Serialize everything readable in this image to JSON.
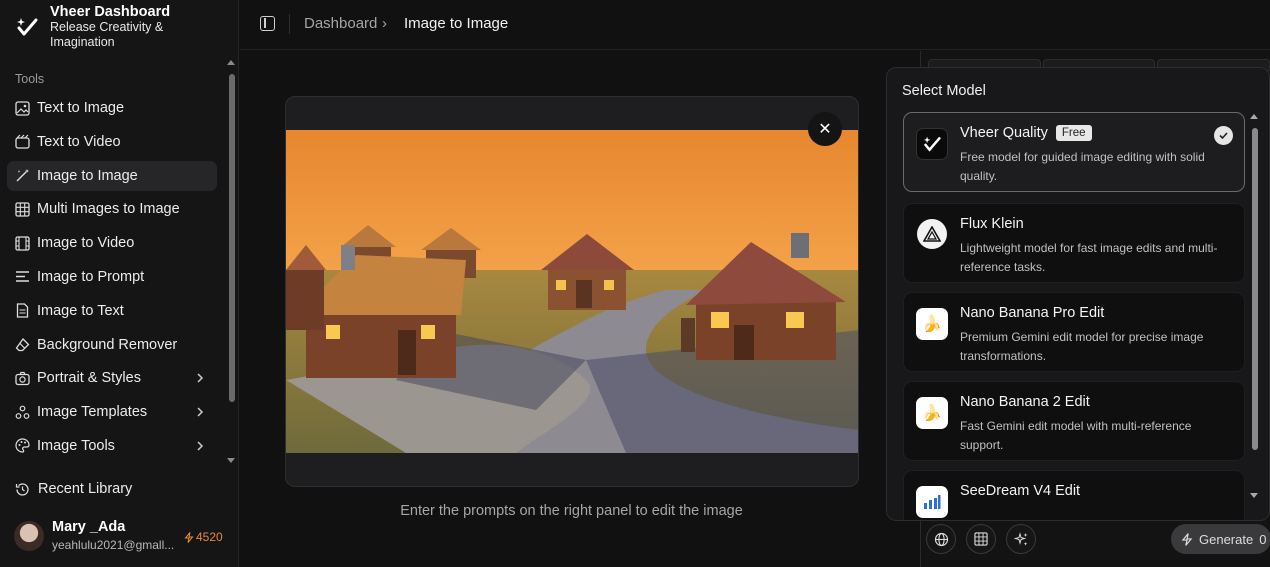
{
  "brand": {
    "title": "Vheer Dashboard",
    "subtitle_line1": "Release Creativity &",
    "subtitle_line2": "Imagination"
  },
  "sidebar": {
    "section_label": "Tools",
    "items": [
      {
        "label": "Text to Image",
        "icon": "image-icon"
      },
      {
        "label": "Text to Video",
        "icon": "video-icon"
      },
      {
        "label": "Image to Image",
        "icon": "magic-wand-icon",
        "active": true
      },
      {
        "label": "Multi Images to Image",
        "icon": "grid-icon"
      },
      {
        "label": "Image to Video",
        "icon": "film-icon"
      },
      {
        "label": "Image to Prompt",
        "icon": "text-lines-icon"
      },
      {
        "label": "Image to Text",
        "icon": "document-icon"
      },
      {
        "label": "Background Remover",
        "icon": "eraser-icon"
      },
      {
        "label": "Portrait & Styles",
        "icon": "camera-icon",
        "has_submenu": true
      },
      {
        "label": "Image Templates",
        "icon": "templates-icon",
        "has_submenu": true
      },
      {
        "label": "Image Tools",
        "icon": "palette-icon",
        "has_submenu": true
      }
    ],
    "recent": "Recent Library",
    "user": {
      "name": "Mary _Ada",
      "email": "yeahlulu2021@gmall...",
      "credits": "4520"
    }
  },
  "header": {
    "crumb_parent": "Dashboard",
    "crumb_current": "Image to Image"
  },
  "main": {
    "caption": "Enter the prompts on the right panel to edit the image"
  },
  "model_popup": {
    "title": "Select Model",
    "models": [
      {
        "name": "Vheer Quality",
        "badge": "Free",
        "desc": "Free model for guided image editing with solid quality.",
        "selected": true
      },
      {
        "name": "Flux Klein",
        "desc": "Lightweight model for fast image edits and multi-reference tasks."
      },
      {
        "name": "Nano Banana Pro Edit",
        "desc": "Premium Gemini edit model for precise image transformations."
      },
      {
        "name": "Nano Banana 2 Edit",
        "desc": "Fast Gemini edit model with multi-reference support."
      },
      {
        "name": "SeeDream V4 Edit",
        "desc": ""
      }
    ]
  },
  "toolbar": {
    "generate_label": "Generate",
    "generate_cost": "0"
  },
  "colors": {
    "accent_orange": "#e9893a",
    "background": "#111112"
  }
}
